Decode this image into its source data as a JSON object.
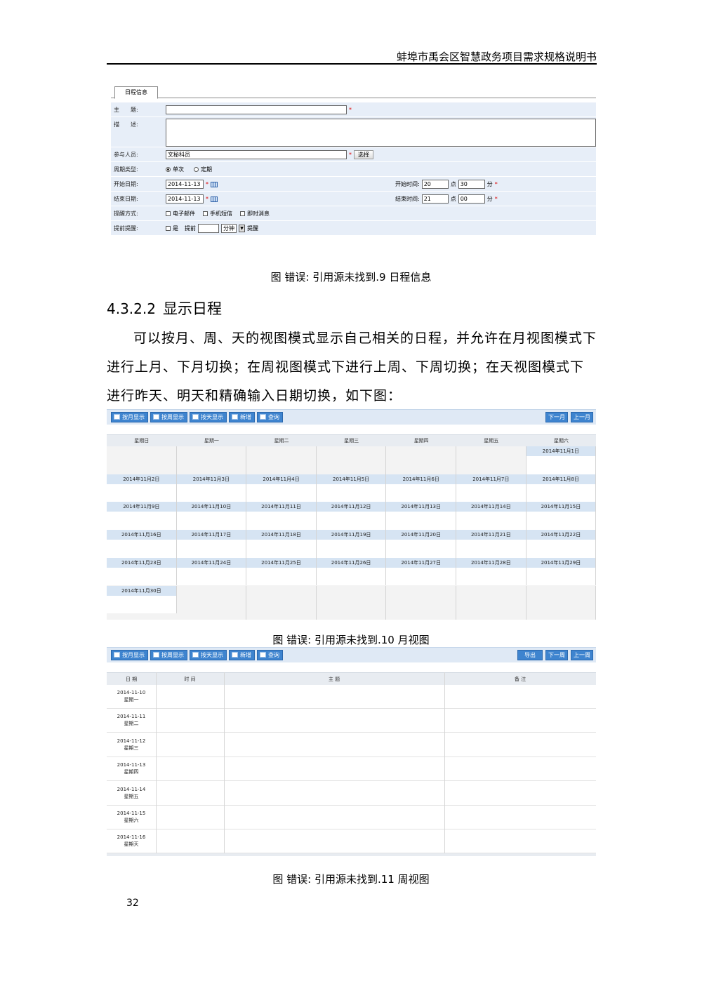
{
  "header": {
    "title": "蚌埠市禹会区智慧政务项目需求规格说明书"
  },
  "form": {
    "tab": "日程信息",
    "subject_label": "主　　题:",
    "desc_label": "描　　述:",
    "participants_label": "参与人员:",
    "participants_value": "文秘科员",
    "select_button": "选择",
    "cycle_label": "周期类型:",
    "cycle_once": "单次",
    "cycle_fixed": "定期",
    "start_date_label": "开始日期:",
    "start_date_value": "2014-11-13",
    "end_date_label": "结束日期:",
    "end_date_value": "2014-11-13",
    "start_time_label": "开始时间:",
    "start_hour": "20",
    "start_min": "30",
    "end_time_label": "结束时间:",
    "end_hour": "21",
    "end_min": "00",
    "hour_unit": "点",
    "min_unit": "分",
    "remind_label": "提醒方式:",
    "remind_email": "电子邮件",
    "remind_sms": "手机短信",
    "remind_im": "即时消息",
    "advance_label": "提前提醒:",
    "advance_yes": "是",
    "advance_prefix": "提前",
    "advance_unit": "分钟",
    "advance_suffix": "提醒",
    "required_mark": "*"
  },
  "captions": {
    "fig9": "图 错误: 引用源未找到.9 日程信息",
    "fig10": "图 错误: 引用源未找到.10 月视图",
    "fig11": "图 错误: 引用源未找到.11 周视图"
  },
  "section": {
    "number": "4.3.2.2",
    "title": "显示日程"
  },
  "body_text": "可以按月、周、天的视图模式显示自己相关的日程，并允许在月视图模式下进行上月、下月切换；在周视图模式下进行上周、下周切换；在天视图模式下进行昨天、明天和精确输入日期切换，如下图：",
  "month_view": {
    "toolbar_left": [
      "按月显示",
      "按周显示",
      "按天显示",
      "新增",
      "查询"
    ],
    "toolbar_right": [
      "下一月",
      "上一月"
    ],
    "weekdays": [
      "星期日",
      "星期一",
      "星期二",
      "星期三",
      "星期四",
      "星期五",
      "星期六"
    ],
    "weeks": [
      [
        "",
        "",
        "",
        "",
        "",
        "",
        "2014年11月1日"
      ],
      [
        "2014年11月2日",
        "2014年11月3日",
        "2014年11月4日",
        "2014年11月5日",
        "2014年11月6日",
        "2014年11月7日",
        "2014年11月8日"
      ],
      [
        "2014年11月9日",
        "2014年11月10日",
        "2014年11月11日",
        "2014年11月12日",
        "2014年11月13日",
        "2014年11月14日",
        "2014年11月15日"
      ],
      [
        "2014年11月16日",
        "2014年11月17日",
        "2014年11月18日",
        "2014年11月19日",
        "2014年11月20日",
        "2014年11月21日",
        "2014年11月22日"
      ],
      [
        "2014年11月23日",
        "2014年11月24日",
        "2014年11月25日",
        "2014年11月26日",
        "2014年11月27日",
        "2014年11月28日",
        "2014年11月29日"
      ],
      [
        "2014年11月30日",
        "",
        "",
        "",
        "",
        "",
        ""
      ]
    ]
  },
  "week_view": {
    "toolbar_left": [
      "按月显示",
      "按周显示",
      "按天显示",
      "新增",
      "查询"
    ],
    "toolbar_right": [
      "导出",
      "下一周",
      "上一周"
    ],
    "columns": [
      "日 期",
      "时 间",
      "主 题",
      "备 注"
    ],
    "rows": [
      {
        "date": "2014-11-10",
        "day": "星期一"
      },
      {
        "date": "2014-11-11",
        "day": "星期二"
      },
      {
        "date": "2014-11-12",
        "day": "星期三"
      },
      {
        "date": "2014-11-13",
        "day": "星期四"
      },
      {
        "date": "2014-11-14",
        "day": "星期五"
      },
      {
        "date": "2014-11-15",
        "day": "星期六"
      },
      {
        "date": "2014-11-16",
        "day": "星期天"
      }
    ]
  },
  "page_number": "32"
}
